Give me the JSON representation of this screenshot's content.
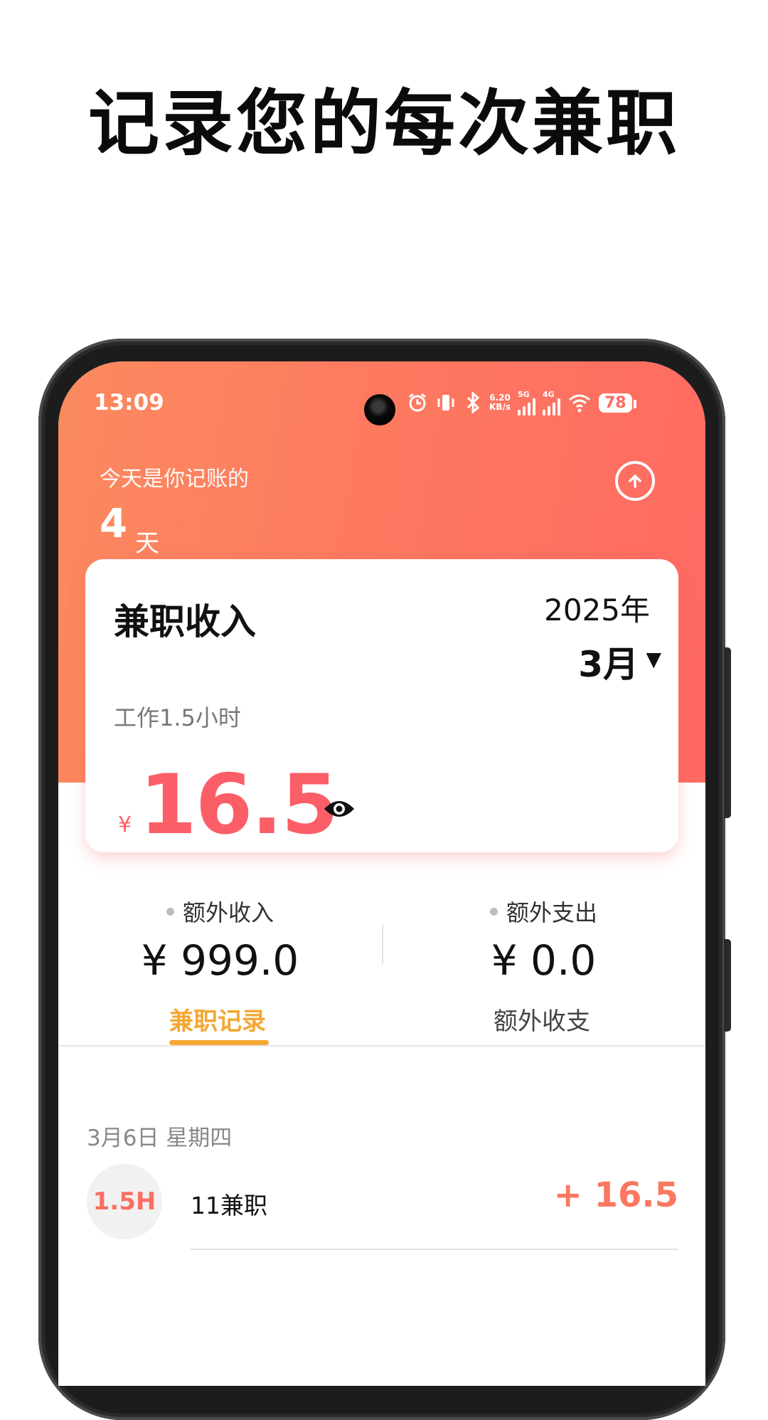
{
  "promo": {
    "headline": "记录您的每次兼职"
  },
  "status_bar": {
    "time": "13:09",
    "net_speed": "6.20",
    "net_speed_unit": "KB/s",
    "net_5g": "5G",
    "net_4g": "4G",
    "battery": "78",
    "icons": [
      "alarm-icon",
      "vibrate-icon",
      "bluetooth-icon",
      "signal-5g-icon",
      "signal-4g-icon",
      "wifi-icon",
      "battery-icon"
    ]
  },
  "header": {
    "streak_label": "今天是你记账的",
    "streak_days": "4",
    "streak_unit": "天",
    "upload_icon": "upload-icon"
  },
  "income_card": {
    "title": "兼职收入",
    "year": "2025年",
    "month": "3月",
    "hours_text": "工作1.5小时",
    "currency": "¥",
    "amount": "16.5",
    "visibility_icon": "eye-icon"
  },
  "extras": {
    "income": {
      "label": "额外收入",
      "value": "¥ 999.0"
    },
    "expense": {
      "label": "额外支出",
      "value": "¥ 0.0"
    }
  },
  "tabs": [
    {
      "label": "兼职记录",
      "active": true
    },
    {
      "label": "额外收支",
      "active": false
    }
  ],
  "records": {
    "date_header": "3月6日 星期四",
    "items": [
      {
        "hours": "1.5H",
        "title": "11兼职",
        "amount": "+ 16.5"
      }
    ]
  },
  "colors": {
    "accent_red": "#fb5e67",
    "tab_active": "#f4a733",
    "header_gradient_start": "#fb8a5f",
    "header_gradient_end": "#fe6962"
  }
}
